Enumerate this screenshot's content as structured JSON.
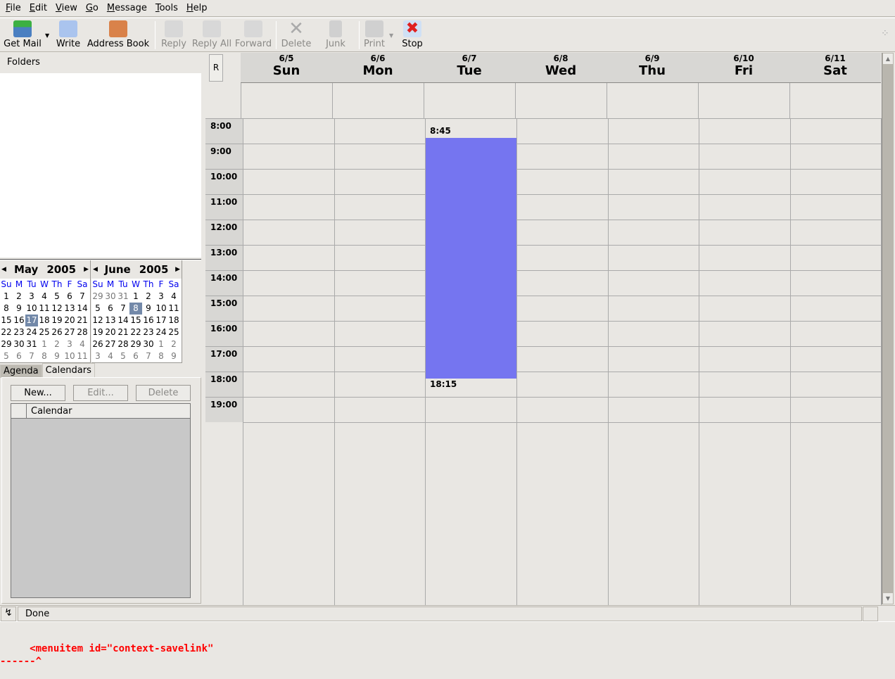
{
  "menu": [
    "File",
    "Edit",
    "View",
    "Go",
    "Message",
    "Tools",
    "Help"
  ],
  "toolbar": {
    "get_mail": "Get Mail",
    "write": "Write",
    "address_book": "Address Book",
    "reply": "Reply",
    "reply_all": "Reply All",
    "forward": "Forward",
    "delete": "Delete",
    "junk": "Junk",
    "print": "Print",
    "stop": "Stop"
  },
  "sidebar": {
    "folders_label": "Folders"
  },
  "mini_calendars": [
    {
      "month": "May",
      "year": "2005",
      "dow": [
        "Su",
        "M",
        "Tu",
        "W",
        "Th",
        "F",
        "Sa"
      ],
      "selected": "17",
      "weeks": [
        [
          "1",
          "2",
          "3",
          "4",
          "5",
          "6",
          "7"
        ],
        [
          "8",
          "9",
          "10",
          "11",
          "12",
          "13",
          "14"
        ],
        [
          "15",
          "16",
          "17",
          "18",
          "19",
          "20",
          "21"
        ],
        [
          "22",
          "23",
          "24",
          "25",
          "26",
          "27",
          "28"
        ],
        [
          "29",
          "30",
          "31",
          "1",
          "2",
          "3",
          "4"
        ],
        [
          "5",
          "6",
          "7",
          "8",
          "9",
          "10",
          "11"
        ]
      ]
    },
    {
      "month": "June",
      "year": "2005",
      "dow": [
        "Su",
        "M",
        "Tu",
        "W",
        "Th",
        "F",
        "Sa"
      ],
      "selected": "8",
      "weeks": [
        [
          "29",
          "30",
          "31",
          "1",
          "2",
          "3",
          "4"
        ],
        [
          "5",
          "6",
          "7",
          "8",
          "9",
          "10",
          "11"
        ],
        [
          "12",
          "13",
          "14",
          "15",
          "16",
          "17",
          "18"
        ],
        [
          "19",
          "20",
          "21",
          "22",
          "23",
          "24",
          "25"
        ],
        [
          "26",
          "27",
          "28",
          "29",
          "30",
          "1",
          "2"
        ],
        [
          "3",
          "4",
          "5",
          "6",
          "7",
          "8",
          "9"
        ]
      ]
    }
  ],
  "tabs": {
    "agenda": "Agenda",
    "calendars": "Calendars"
  },
  "calendars_panel": {
    "new": "New...",
    "edit": "Edit...",
    "delete": "Delete",
    "column": "Calendar"
  },
  "week_view": {
    "r_button": "R",
    "days": [
      {
        "date": "6/5",
        "name": "Sun"
      },
      {
        "date": "6/6",
        "name": "Mon"
      },
      {
        "date": "6/7",
        "name": "Tue"
      },
      {
        "date": "6/8",
        "name": "Wed"
      },
      {
        "date": "6/9",
        "name": "Thu"
      },
      {
        "date": "6/10",
        "name": "Fri"
      },
      {
        "date": "6/11",
        "name": "Sat"
      }
    ],
    "hours": [
      "8:00",
      "9:00",
      "10:00",
      "11:00",
      "12:00",
      "13:00",
      "14:00",
      "15:00",
      "16:00",
      "17:00",
      "18:00",
      "19:00"
    ],
    "event": {
      "day": "Tue",
      "start": "8:45",
      "end": "18:15",
      "color": "#7575f0"
    }
  },
  "status": {
    "text": "Done"
  },
  "error": {
    "line1": "     <menuitem id=\"context-savelink\"",
    "line2": "------^"
  }
}
